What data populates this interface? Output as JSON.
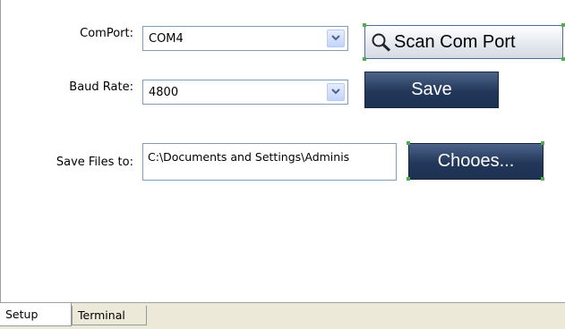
{
  "form": {
    "comport_label": "ComPort:",
    "comport_value": "COM4",
    "baud_label": "Baud Rate:",
    "baud_value": "4800",
    "save_files_label": "Save Files to:",
    "save_path": "C:\\Documents and Settings\\Adminis"
  },
  "buttons": {
    "scan": "Scan Com Port",
    "save": "Save",
    "choose": "Chooes..."
  },
  "tabs": [
    {
      "label": "Setup"
    },
    {
      "label": "Terminal"
    }
  ],
  "icons": {
    "scan": "magnifier-icon",
    "dropdown": "chevron-down-icon"
  }
}
